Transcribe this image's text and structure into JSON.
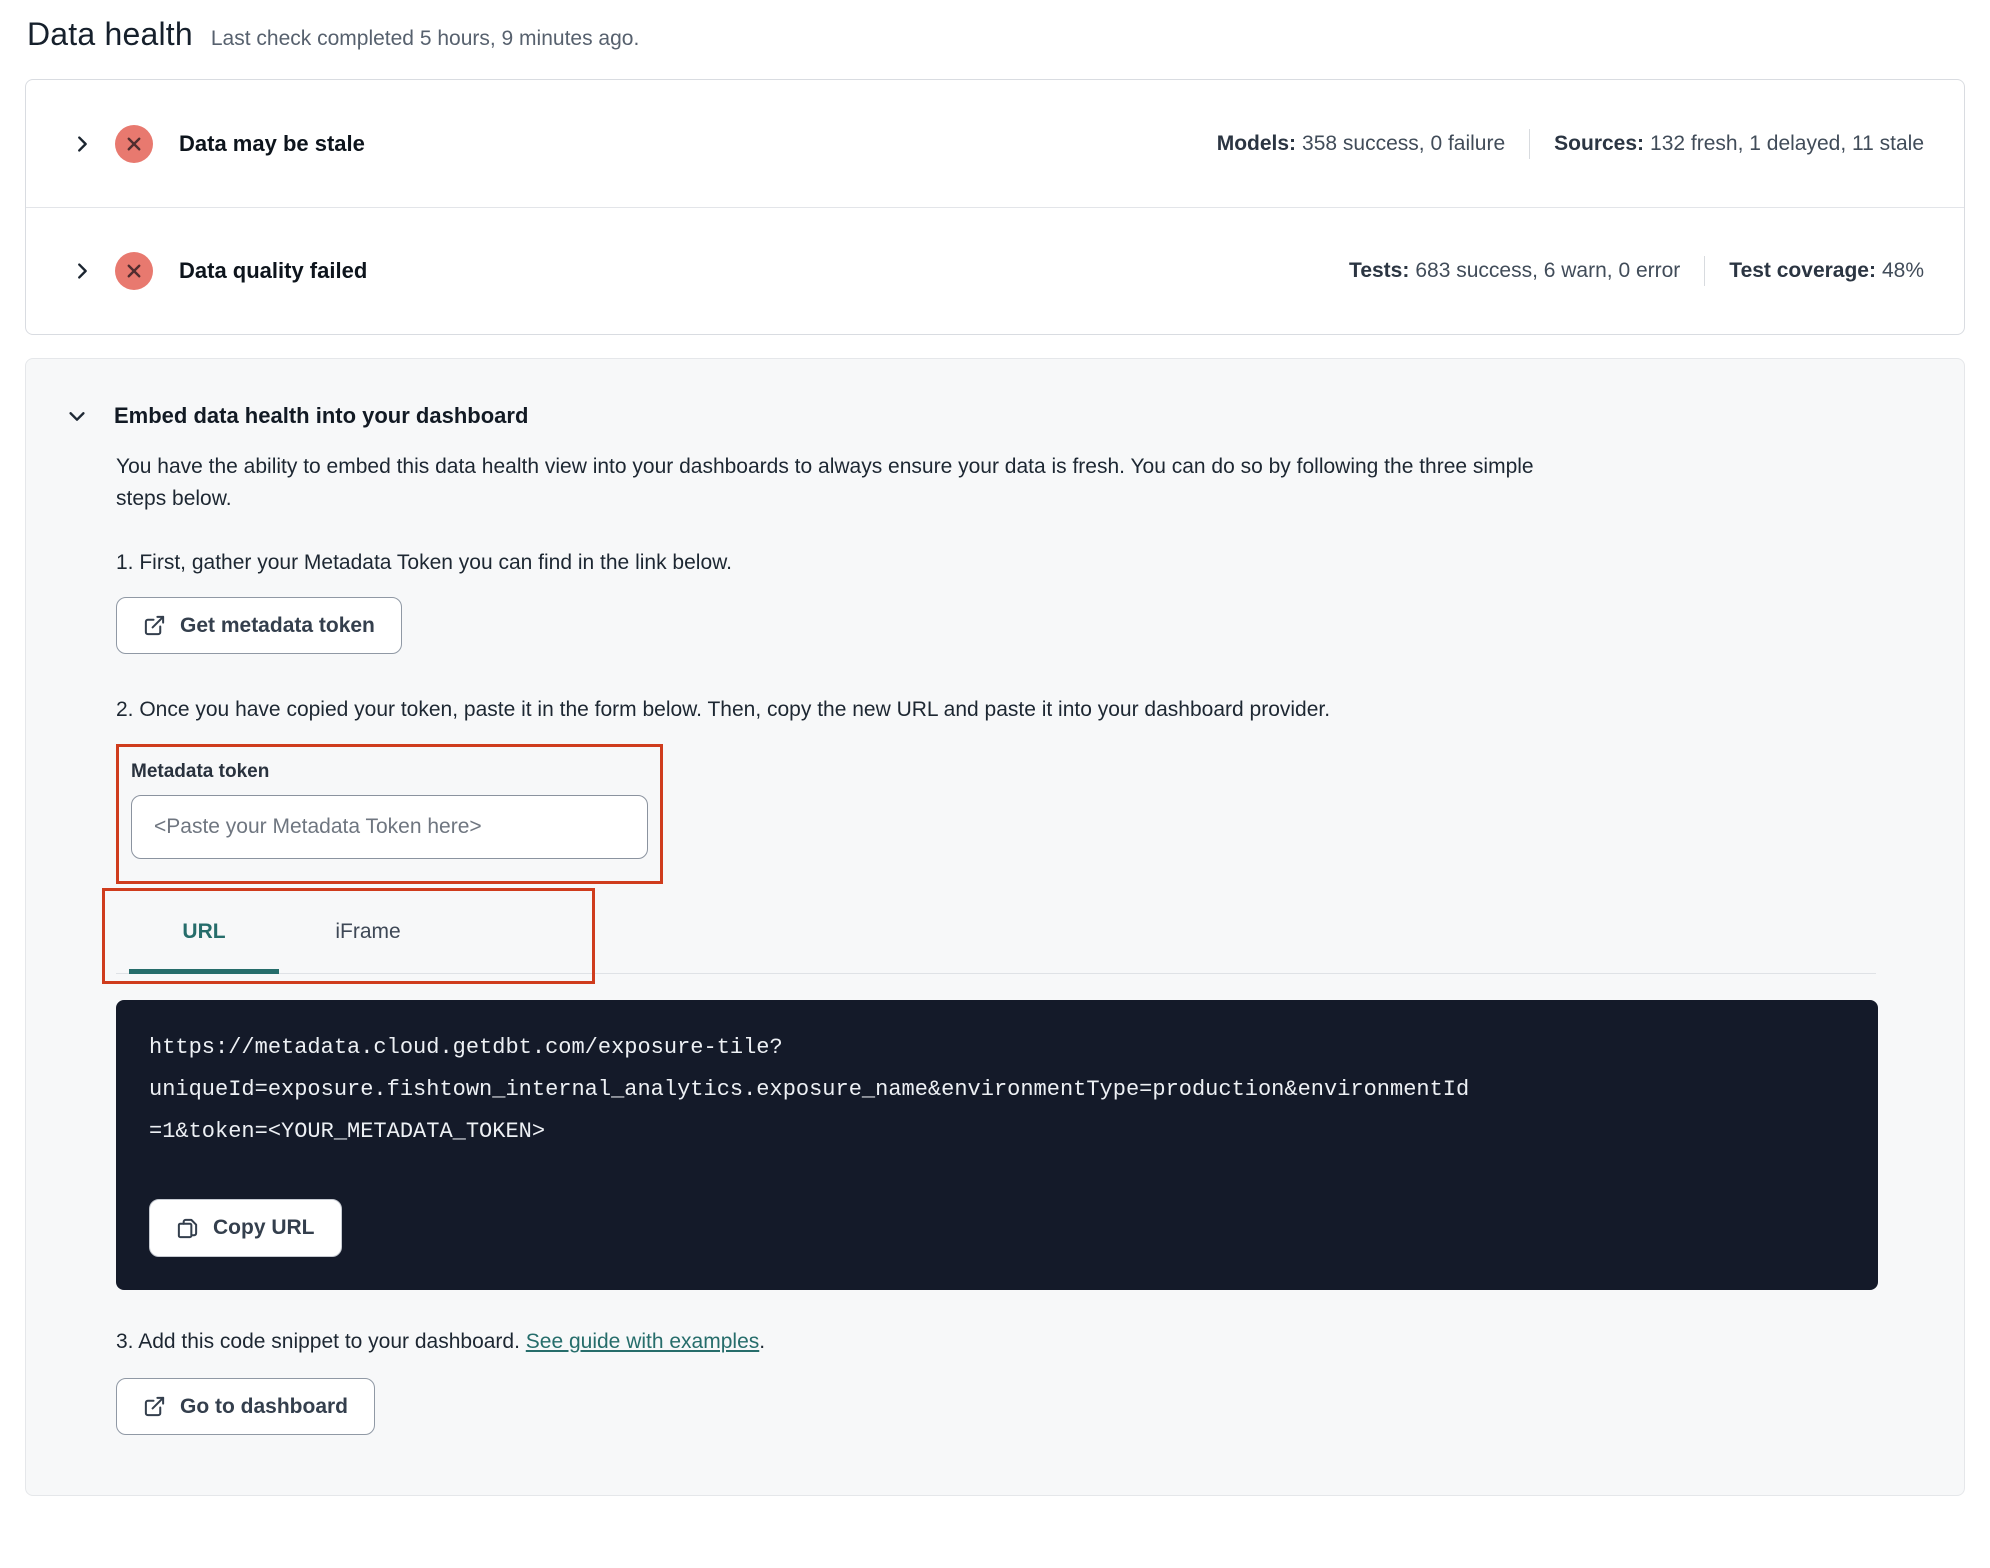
{
  "page": {
    "title": "Data health",
    "subtitle": "Last check completed 5 hours, 9 minutes ago."
  },
  "status_rows": [
    {
      "label": "Data may be stale",
      "icon": "error-x-circle",
      "stats": [
        {
          "label": "Models:",
          "value": "358 success, 0 failure"
        },
        {
          "label": "Sources:",
          "value": "132 fresh, 1 delayed, 11 stale"
        }
      ]
    },
    {
      "label": "Data quality failed",
      "icon": "error-x-circle",
      "stats": [
        {
          "label": "Tests:",
          "value": "683 success, 6 warn, 0 error"
        },
        {
          "label": "Test coverage:",
          "value": "48%"
        }
      ]
    }
  ],
  "embed": {
    "heading": "Embed data health into your dashboard",
    "description": "You have the ability to embed this data health view into your dashboards to always ensure your data is fresh. You can do so by following the three simple steps below.",
    "step1": "1. First, gather your Metadata Token you can find in the link below.",
    "get_token_button": "Get metadata token",
    "step2": "2. Once you have copied your token, paste it in the form below. Then, copy the new URL and paste it into your dashboard provider.",
    "token_field": {
      "label": "Metadata token",
      "placeholder": "<Paste your Metadata Token here>",
      "value": ""
    },
    "tabs": [
      {
        "label": "URL",
        "active": true
      },
      {
        "label": "iFrame",
        "active": false
      }
    ],
    "code_url": "https://metadata.cloud.getdbt.com/exposure-tile?uniqueId=exposure.fishtown_internal_analytics.exposure_name&environmentType=production&environmentId=1&token=<YOUR_METADATA_TOKEN>",
    "code_lines": [
      "https://metadata.cloud.getdbt.com/exposure-tile?",
      "uniqueId=exposure.fishtown_internal_analytics.exposure_name&environmentType=production&environmentId",
      "=1&token=<YOUR_METADATA_TOKEN>"
    ],
    "copy_button": "Copy URL",
    "step3_prefix": "3. Add this code snippet to your dashboard. ",
    "step3_link": "See guide with examples",
    "step3_suffix": ".",
    "dashboard_button": "Go to dashboard"
  },
  "colors": {
    "annotation_red": "#cf3c1d",
    "teal_accent": "#266d6b",
    "error_badge_bg": "#e8796f",
    "error_badge_x": "#512d2f",
    "code_block_bg": "#141a29",
    "embed_card_bg": "#f7f8f9"
  }
}
